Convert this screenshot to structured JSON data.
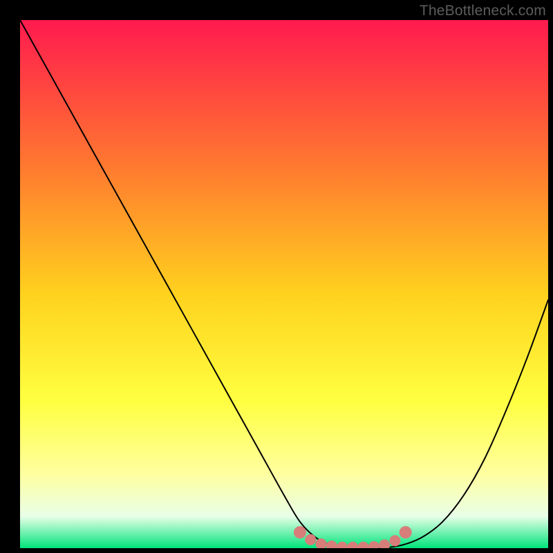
{
  "watermark": "TheBottleneck.com",
  "colors": {
    "bg": "#000000",
    "grad_top": "#ff1a4e",
    "grad_mid_upper": "#ff7a2f",
    "grad_mid": "#ffd21e",
    "grad_mid_lower": "#ffff40",
    "grad_pale": "#ffffa0",
    "grad_near_bottom": "#e8ffe8",
    "grad_bottom": "#00e47a",
    "curve": "#000000",
    "marker_fill": "#d77d7a",
    "marker_stroke": "#c96864"
  },
  "chart_data": {
    "type": "line",
    "title": "",
    "xlabel": "",
    "ylabel": "",
    "xlim": [
      0,
      100
    ],
    "ylim": [
      0,
      100
    ],
    "series": [
      {
        "name": "bottleneck-curve",
        "x": [
          0,
          5,
          10,
          15,
          20,
          25,
          30,
          35,
          40,
          45,
          50,
          53,
          56,
          59,
          62,
          65,
          68,
          72,
          76,
          80,
          84,
          88,
          92,
          96,
          100
        ],
        "y": [
          100,
          91,
          82,
          73,
          64,
          55,
          46,
          37,
          28,
          19,
          10,
          5,
          2,
          0.5,
          0,
          0,
          0,
          0.5,
          2,
          5,
          10,
          17,
          26,
          36,
          47
        ]
      }
    ],
    "markers": {
      "name": "flat-region-markers",
      "x": [
        53,
        55,
        57,
        59,
        61,
        63,
        65,
        67,
        69,
        71,
        73
      ],
      "y": [
        3.0,
        1.6,
        0.8,
        0.4,
        0.2,
        0.2,
        0.2,
        0.3,
        0.6,
        1.4,
        3.0
      ]
    }
  }
}
